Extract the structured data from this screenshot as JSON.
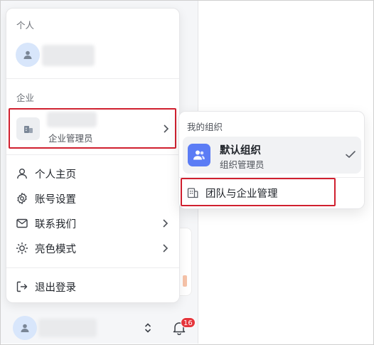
{
  "menu": {
    "personal_section": "个人",
    "enterprise_section": "企业",
    "enterprise_role": "企业管理员",
    "items": [
      {
        "label": "个人主页",
        "icon": "user-icon"
      },
      {
        "label": "账号设置",
        "icon": "gear-icon"
      },
      {
        "label": "联系我们",
        "icon": "mail-icon"
      },
      {
        "label": "亮色模式",
        "icon": "sun-icon"
      }
    ],
    "logout_label": "退出登录"
  },
  "footer": {
    "notification_count": "16"
  },
  "submenu": {
    "title": "我的组织",
    "org_name": "默认组织",
    "org_role": "组织管理员",
    "team_manage_label": "团队与企业管理"
  },
  "colors": {
    "highlight_border": "#d0202f",
    "org_logo_bg": "#5b7cf5",
    "badge": "#e5353b",
    "avatar_bg": "#d8e6fb"
  }
}
